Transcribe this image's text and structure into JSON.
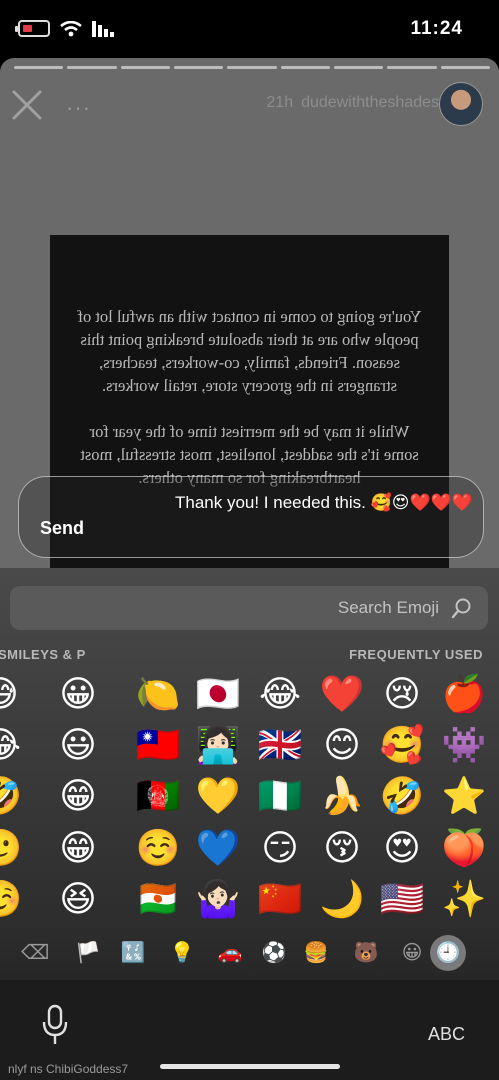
{
  "status": {
    "time": "11:24"
  },
  "story": {
    "username": "dudewiththeshades",
    "age": "21h",
    "more": "···",
    "card_text": "You're going to come in contact with an awful lot of people who are at their absolute breaking point this season. Friends, family, co-workers, teachers, strangers in the grocery store, retail workers.\n\nWhile it may be the merriest time of the year for some it's the saddest, loneliest, most stressful, most heartbreaking for so many others."
  },
  "reply": {
    "text": "Thank you! I needed this. 🥰😍❤️❤️❤️",
    "send_label": "Send"
  },
  "keyboard": {
    "search_placeholder": "Search Emoji",
    "category_frequent": "FREQUENTLY USED",
    "category_smileys": "SMILEYS & P",
    "abc_label": "ABC",
    "emoji_columns": [
      [
        "🍎",
        "👾",
        "⭐",
        "🍑",
        "✨"
      ],
      [
        "😢",
        "🥰",
        "🤣",
        "😍",
        "🇺🇸"
      ],
      [
        "❤️",
        "😊",
        "🍌",
        "😚",
        "🌙"
      ],
      [
        "😂",
        "🇬🇧",
        "🇳🇬",
        "😏",
        "🇨🇳"
      ],
      [
        "🇯🇵",
        "👩🏻‍💻",
        "💛",
        "💙",
        "🤷🏻‍♀️"
      ],
      [
        "🍋",
        "🇹🇼",
        "🇦🇫",
        "☺️",
        "🇳🇪"
      ],
      [
        "😀",
        "😃",
        "😁",
        "😁",
        "😆"
      ],
      [
        "😅",
        "😂",
        "🤣",
        "🥲",
        "☺️"
      ]
    ],
    "tabs": [
      "🕘",
      "😀",
      "🐻",
      "🍔",
      "⚽",
      "🚗",
      "💡",
      "🔣",
      "🏳️",
      "⌫"
    ]
  },
  "caption": "nlyf  ns ChibiGoddess7"
}
